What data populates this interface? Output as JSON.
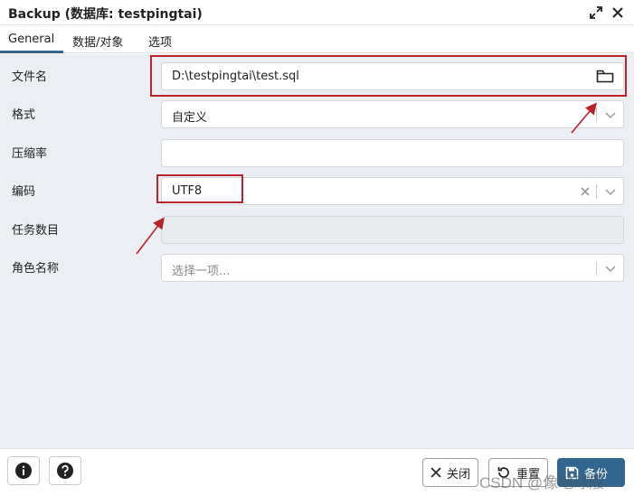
{
  "window": {
    "title": "Backup (数据库: testpingtai)",
    "expand_icon": "expand-icon",
    "close_icon": "close-icon"
  },
  "tabs": [
    {
      "label": "General",
      "active": true
    },
    {
      "label": "数据/对象",
      "active": false
    },
    {
      "label": "选项",
      "active": false
    }
  ],
  "form": {
    "filename": {
      "label": "文件名",
      "value": "D:\\testpingtai\\test.sql",
      "icon": "folder-icon"
    },
    "format": {
      "label": "格式",
      "value": "自定义"
    },
    "compression": {
      "label": "压缩率",
      "value": ""
    },
    "encoding": {
      "label": "编码",
      "value": "UTF8"
    },
    "jobs": {
      "label": "任务数目",
      "value": ""
    },
    "role": {
      "label": "角色名称",
      "placeholder": "选择一项..."
    }
  },
  "footer": {
    "info_icon": "info-icon",
    "help_icon": "help-icon",
    "close_label": "关闭",
    "reset_label": "重置",
    "backup_label": "备份"
  },
  "watermark": "CSDN @像地球般"
}
